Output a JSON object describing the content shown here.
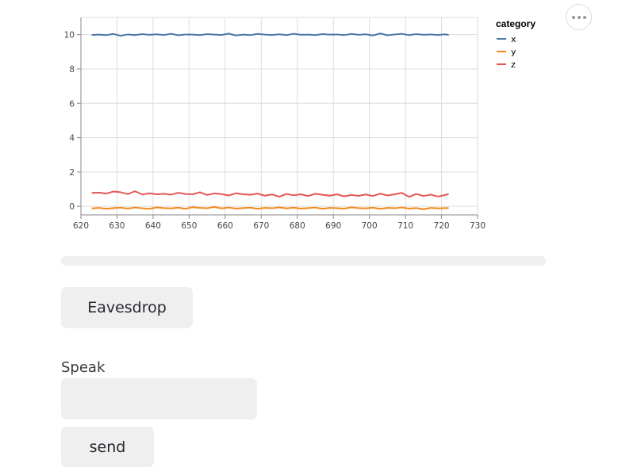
{
  "chart_data": {
    "type": "line",
    "title": "",
    "xlabel": "",
    "ylabel": "",
    "xlim": [
      620,
      730
    ],
    "ylim": [
      -0.5,
      11
    ],
    "x_ticks": [
      620,
      630,
      640,
      650,
      660,
      670,
      680,
      690,
      700,
      710,
      720,
      730
    ],
    "y_ticks": [
      0,
      2,
      4,
      6,
      8,
      10
    ],
    "grid": true,
    "legend": {
      "title": "category",
      "placement": "right"
    },
    "x": [
      623,
      625,
      627,
      629,
      631,
      633,
      635,
      637,
      639,
      641,
      643,
      645,
      647,
      649,
      651,
      653,
      655,
      657,
      659,
      661,
      663,
      665,
      667,
      669,
      671,
      673,
      675,
      677,
      679,
      681,
      683,
      685,
      687,
      689,
      691,
      693,
      695,
      697,
      699,
      701,
      703,
      705,
      707,
      709,
      711,
      713,
      715,
      717,
      719,
      721,
      722
    ],
    "series": [
      {
        "name": "x",
        "color": "#4c78a8",
        "values": [
          9.98,
          10.0,
          9.97,
          10.04,
          9.93,
          10.01,
          9.97,
          10.03,
          9.99,
          10.02,
          9.98,
          10.05,
          9.96,
          10.01,
          10.0,
          9.97,
          10.03,
          10.0,
          9.98,
          10.06,
          9.95,
          10.0,
          9.97,
          10.04,
          10.0,
          9.98,
          10.02,
          9.97,
          10.05,
          9.99,
          10.0,
          9.97,
          10.03,
          10.0,
          10.01,
          9.97,
          10.04,
          9.99,
          10.02,
          9.95,
          10.07,
          9.96,
          10.01,
          10.05,
          9.97,
          10.03,
          9.99,
          10.01,
          9.98,
          10.02,
          9.98
        ]
      },
      {
        "name": "y",
        "color": "#f58518",
        "values": [
          -0.12,
          -0.09,
          -0.14,
          -0.1,
          -0.08,
          -0.13,
          -0.07,
          -0.11,
          -0.15,
          -0.06,
          -0.1,
          -0.12,
          -0.08,
          -0.14,
          -0.05,
          -0.09,
          -0.11,
          -0.04,
          -0.12,
          -0.07,
          -0.13,
          -0.1,
          -0.08,
          -0.14,
          -0.09,
          -0.11,
          -0.06,
          -0.12,
          -0.08,
          -0.13,
          -0.1,
          -0.07,
          -0.14,
          -0.09,
          -0.11,
          -0.13,
          -0.06,
          -0.1,
          -0.12,
          -0.08,
          -0.15,
          -0.09,
          -0.11,
          -0.07,
          -0.13,
          -0.1,
          -0.17,
          -0.09,
          -0.12,
          -0.1,
          -0.1
        ]
      },
      {
        "name": "z",
        "color": "#e45756",
        "values": [
          0.78,
          0.8,
          0.74,
          0.86,
          0.82,
          0.71,
          0.88,
          0.69,
          0.76,
          0.7,
          0.73,
          0.68,
          0.79,
          0.72,
          0.7,
          0.82,
          0.66,
          0.75,
          0.71,
          0.63,
          0.76,
          0.7,
          0.67,
          0.74,
          0.62,
          0.69,
          0.56,
          0.72,
          0.64,
          0.7,
          0.6,
          0.73,
          0.67,
          0.62,
          0.7,
          0.58,
          0.66,
          0.61,
          0.69,
          0.6,
          0.74,
          0.63,
          0.7,
          0.78,
          0.55,
          0.72,
          0.6,
          0.68,
          0.57,
          0.66,
          0.72
        ]
      }
    ]
  },
  "controls": {
    "eavesdrop_label": "Eavesdrop",
    "speak_label": "Speak",
    "speak_value": "",
    "send_label": "send"
  },
  "progress": {
    "fraction": 0
  },
  "icons": {
    "more": "more-horizontal-icon"
  }
}
